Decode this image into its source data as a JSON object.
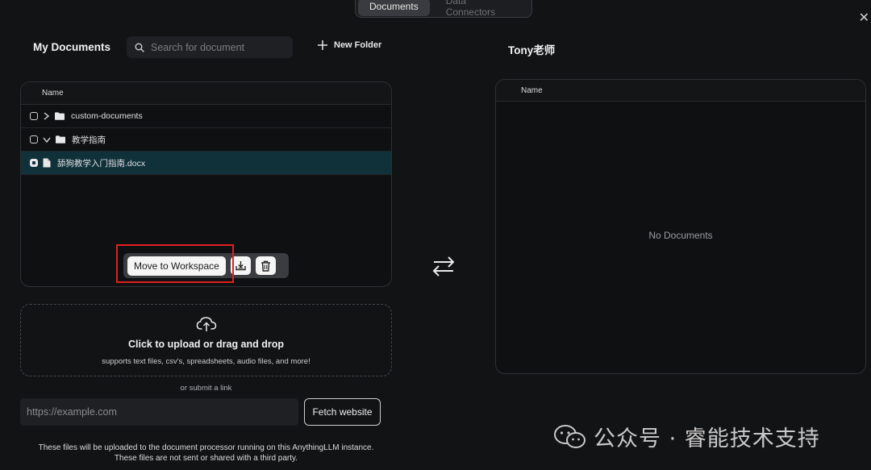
{
  "tabs": [
    {
      "label": "Documents",
      "active": true
    },
    {
      "label": "Data Connectors",
      "active": false
    }
  ],
  "left": {
    "title": "My Documents",
    "search_placeholder": "Search for document",
    "new_folder_label": "New Folder",
    "table_header": "Name",
    "rows": [
      {
        "name": "custom-documents",
        "type": "folder",
        "expanded": false,
        "checked": false
      },
      {
        "name": "教学指南",
        "type": "folder",
        "expanded": true,
        "checked": false
      },
      {
        "name": "舔狗教学入门指南.docx",
        "type": "file",
        "checked": true
      }
    ],
    "move_button": "Move to Workspace"
  },
  "upload": {
    "title": "Click to upload or drag and drop",
    "subtitle": "supports text files, csv's, spreadsheets, audio files, and more!",
    "or_link": "or submit a link",
    "url_placeholder": "https://example.com",
    "fetch_button": "Fetch website",
    "footnote_line1": "These files will be uploaded to the document processor running on this AnythingLLM instance.",
    "footnote_line2": "These files are not sent or shared with a third party."
  },
  "right": {
    "title": "Tony老师",
    "table_header": "Name",
    "empty_text": "No Documents"
  },
  "watermark": "公众号 · 睿能技术支持",
  "colors": {
    "background": "#121315",
    "selected_row": "#10303a",
    "highlight_box": "#e02020"
  }
}
